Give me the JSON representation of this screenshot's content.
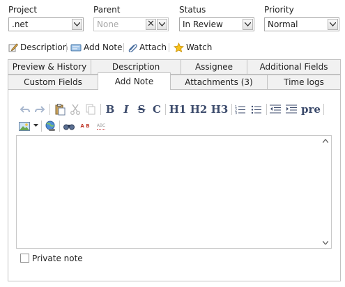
{
  "fields": {
    "project": {
      "label": "Project",
      "value": ".net"
    },
    "parent": {
      "label": "Parent",
      "placeholder": "None"
    },
    "status": {
      "label": "Status",
      "value": "In Review"
    },
    "priority": {
      "label": "Priority",
      "value": "Normal"
    }
  },
  "actions": [
    {
      "label": "Description",
      "icon": "edit-icon"
    },
    {
      "label": "Add Note",
      "icon": "note-icon"
    },
    {
      "label": "Attach",
      "icon": "paperclip-icon"
    },
    {
      "label": "Watch",
      "icon": "star-icon"
    }
  ],
  "tabs": {
    "row1": [
      "Preview & History",
      "Description",
      "Assignee",
      "Additional Fields"
    ],
    "row2": [
      "Custom Fields",
      "Add Note",
      "Attachments (3)",
      "Time logs"
    ],
    "active": "Add Note"
  },
  "toolbar": {
    "strikethrough": "S",
    "code": "C",
    "h1": "H1",
    "h2": "H2",
    "h3": "H3",
    "pre": "pre",
    "spell_label": "ABC",
    "abc_letters": "A B"
  },
  "private_note": {
    "label": "Private note",
    "checked": false
  },
  "colors": {
    "accent_text": "#3b4a6b",
    "border": "#c2c2c2",
    "tab_bg": "#f1f1f1"
  }
}
